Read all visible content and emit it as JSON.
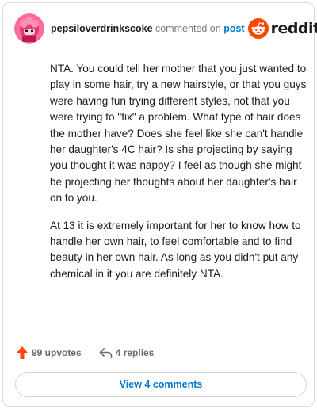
{
  "header": {
    "username": "pepsiloverdrinkscoke",
    "commented_on": "commented on",
    "post_link": "post",
    "brand_word": "reddit"
  },
  "comment": {
    "paragraphs": [
      "NTA. You could tell her mother that you just wanted to play in some hair, try a new hairstyle, or that you guys were having fun trying different styles, not that you were trying to \"fix\" a problem. What type of hair does the mother have? Does she feel like she can't handle her daughter's 4C hair? Is she projecting by saying you thought it was nappy? I feel as though she might be projecting her thoughts about her daughter's hair on to you.",
      "At 13 it is extremely important for her to know how to handle her own hair, to feel comfortable and to find beauty in her own hair. As long as you didn't put any chemical in it you are definitely NTA."
    ]
  },
  "actions": {
    "upvotes": "99 upvotes",
    "replies": "4 replies"
  },
  "view_comments_label": "View 4 comments",
  "colors": {
    "upvote": "#ff4500",
    "link": "#0079d3",
    "avatar": "#ff5a8a"
  },
  "icons": {
    "avatar": "user-avatar",
    "brand": "reddit-logo-icon",
    "upvote": "upvote-arrow-icon",
    "reply": "reply-arrow-icon"
  }
}
